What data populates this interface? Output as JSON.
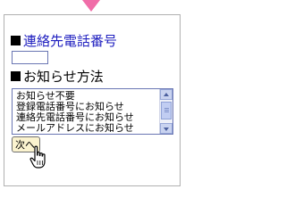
{
  "form": {
    "phone_label": "連絡先電話番号",
    "phone_value": "",
    "method_label": "お知らせ方法",
    "method_options": [
      "お知らせ不要",
      "登録電話番号にお知らせ",
      "連絡先電話番号にお知らせ",
      "メールアドレスにお知らせ"
    ],
    "next_button": "次へ"
  },
  "icons": {
    "header_arrow": "down-triangle-icon",
    "label_bullet": "black-square-icon",
    "cursor": "hand-pointer-icon"
  },
  "colors": {
    "arrow": "#f06da8",
    "phone_label": "#1f1fbf",
    "input_border": "#6a76b3",
    "button_bg": "#fbf3cf"
  }
}
